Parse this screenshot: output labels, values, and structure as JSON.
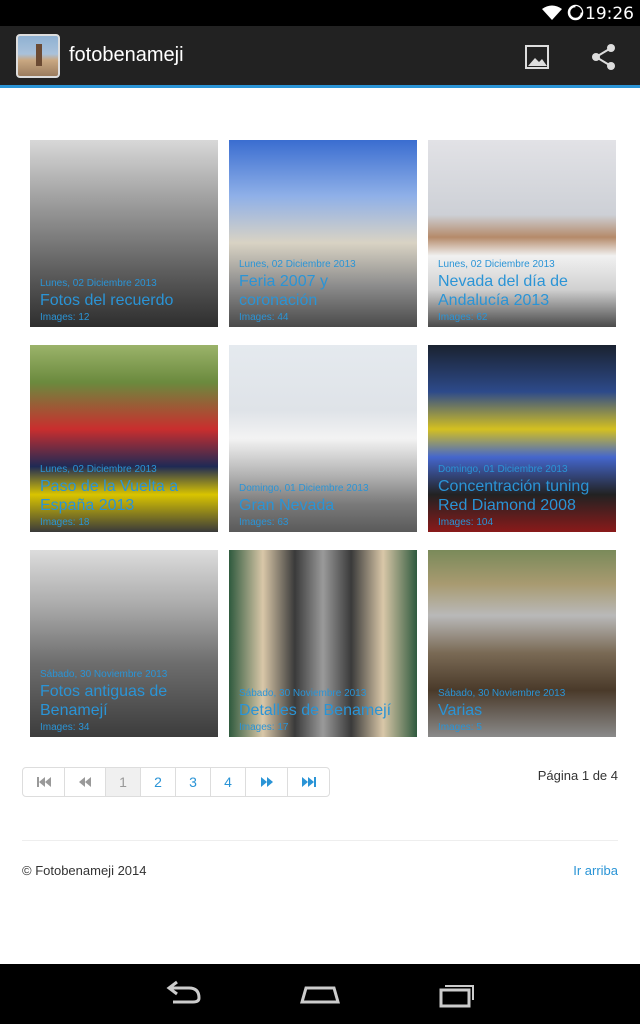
{
  "status": {
    "time": "19:26"
  },
  "app": {
    "title": "fotobenameji"
  },
  "icons": {
    "app": "app-logo-icon",
    "gallery": "image-icon",
    "share": "share-icon",
    "wifi": "wifi-icon",
    "battery": "battery-icon"
  },
  "albums": [
    {
      "date": "Lunes, 02 Diciembre 2013",
      "title": "Fotos del recuerdo",
      "count": "Images: 12"
    },
    {
      "date": "Lunes, 02 Diciembre 2013",
      "title": "Feria 2007 y coronación",
      "count": "Images: 44"
    },
    {
      "date": "Lunes, 02 Diciembre 2013",
      "title": "Nevada del día de Andalucía 2013",
      "count": "Images: 62"
    },
    {
      "date": "Lunes, 02 Diciembre 2013",
      "title": "Paso de la Vuelta a España 2013",
      "count": "Images: 18"
    },
    {
      "date": "Domingo, 01 Diciembre 2013",
      "title": "Gran Nevada",
      "count": "Images: 63"
    },
    {
      "date": "Domingo, 01 Diciembre 2013",
      "title": "Concentración tuning Red Diamond 2008",
      "count": "Images: 104"
    },
    {
      "date": "Sábado, 30 Noviembre 2013",
      "title": "Fotos antiguas de Benamejí",
      "count": "Images: 34"
    },
    {
      "date": "Sábado, 30 Noviembre 2013",
      "title": "Detalles de Benamejí",
      "count": "Images: 17"
    },
    {
      "date": "Sábado, 30 Noviembre 2013",
      "title": "Varias",
      "count": "Images: 5"
    }
  ],
  "pager": {
    "pages": [
      "1",
      "2",
      "3",
      "4"
    ],
    "info": "Página 1 de 4",
    "first": "first-page-icon",
    "prev": "previous-page-icon",
    "next": "next-page-icon",
    "last": "last-page-icon"
  },
  "footer": {
    "copyright": "© Fotobenameji 2014",
    "top_link": "Ir arriba"
  },
  "colors": {
    "accent": "#2a94d6",
    "actionbar": "#222222"
  },
  "nav": {
    "back": "back-icon",
    "home": "home-icon",
    "recents": "recent-apps-icon"
  }
}
